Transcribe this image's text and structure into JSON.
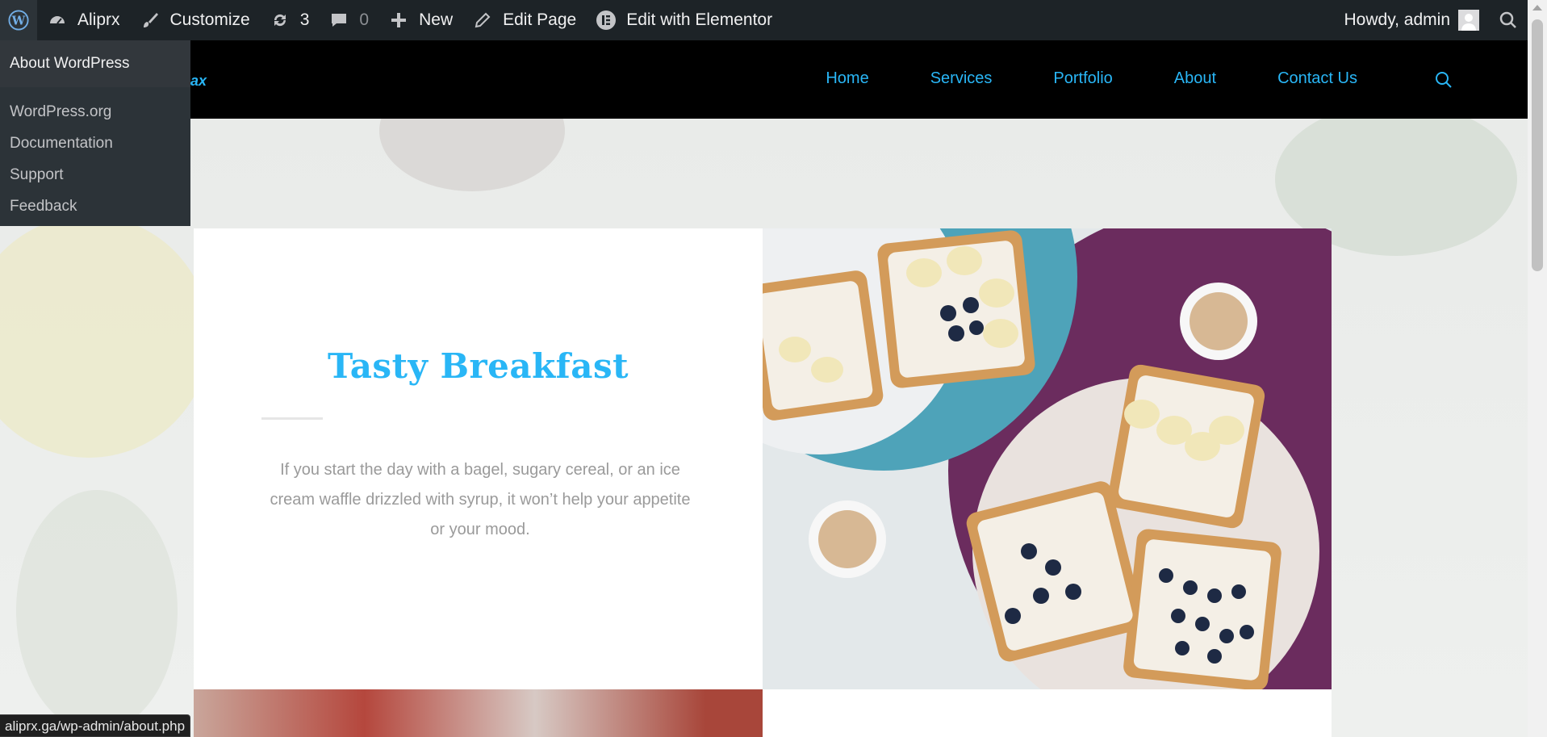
{
  "adminbar": {
    "wp_logo": "wordpress-logo-icon",
    "site_name": "Aliprx",
    "customize": "Customize",
    "updates_count": "3",
    "comments_count": "0",
    "new": "New",
    "edit_page": "Edit Page",
    "edit_elementor": "Edit with Elementor",
    "howdy": "Howdy, admin"
  },
  "wp_menu": {
    "about": "About WordPress",
    "items": [
      "WordPress.org",
      "Documentation",
      "Support",
      "Feedback"
    ]
  },
  "site": {
    "logo_fragment": "ax",
    "nav": [
      "Home",
      "Services",
      "Portfolio",
      "About",
      "Contact Us"
    ]
  },
  "hero": {
    "title": "Tasty Breakfast",
    "text": "If you start the day with a bagel, sugary cereal, or an ice cream waffle drizzled with syrup, it won’t help your appetite or your mood."
  },
  "status_url": "aliprx.ga/wp-admin/about.php",
  "colors": {
    "accent": "#29b6f6",
    "adminbar": "#1d2327",
    "header": "#000000"
  }
}
